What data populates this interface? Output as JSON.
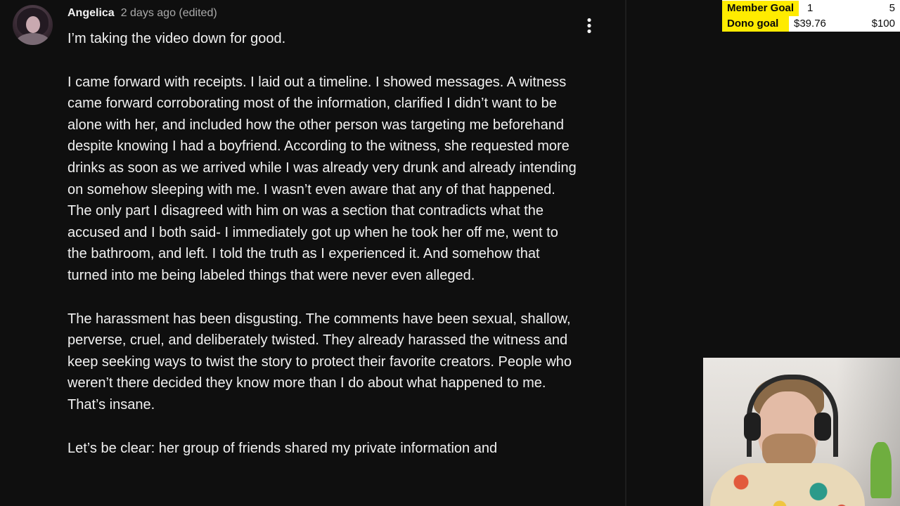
{
  "comment": {
    "author": "Angelica",
    "meta": "2 days ago (edited)",
    "menu_icon": "more-vert-icon",
    "paragraphs": [
      "I’m taking the video down for good.",
      "I came forward with receipts. I laid out a timeline. I showed messages. A witness came forward corroborating most of the information, clarified I didn’t want to be alone with her, and included how the other person was targeting me beforehand despite knowing I had a boyfriend. According to the witness, she requested more drinks as soon as we arrived while I was already very drunk and already intending on somehow sleeping with me. I wasn’t even aware that any of that happened. The only part I disagreed with him on was a section that contradicts what the accused and I both said- I immediately got up when he took her off me, went to the bathroom, and left. I told the truth as I experienced it. And somehow that turned into me being labeled things that were never even alleged.",
      "The harassment has been disgusting. The comments have been sexual, shallow, perverse, cruel, and deliberately twisted. They already harassed the witness and keep seeking ways to twist the story to protect their favorite creators. People who weren’t there decided they know more than I do about what happened to me. That’s insane.",
      "Let’s be clear: her group of friends shared my private information and"
    ]
  },
  "overlay": {
    "goals": [
      {
        "label": "Member Goal",
        "current": "1",
        "target": "5"
      },
      {
        "label": "Dono goal",
        "current": "$39.76",
        "target": "$100"
      }
    ],
    "colors": {
      "label_bg": "#ffeb00",
      "panel_bg": "#ffffff"
    }
  },
  "colors": {
    "background": "#0f0f0f",
    "text_primary": "#f1f1f1",
    "text_secondary": "#aaaaaa"
  }
}
